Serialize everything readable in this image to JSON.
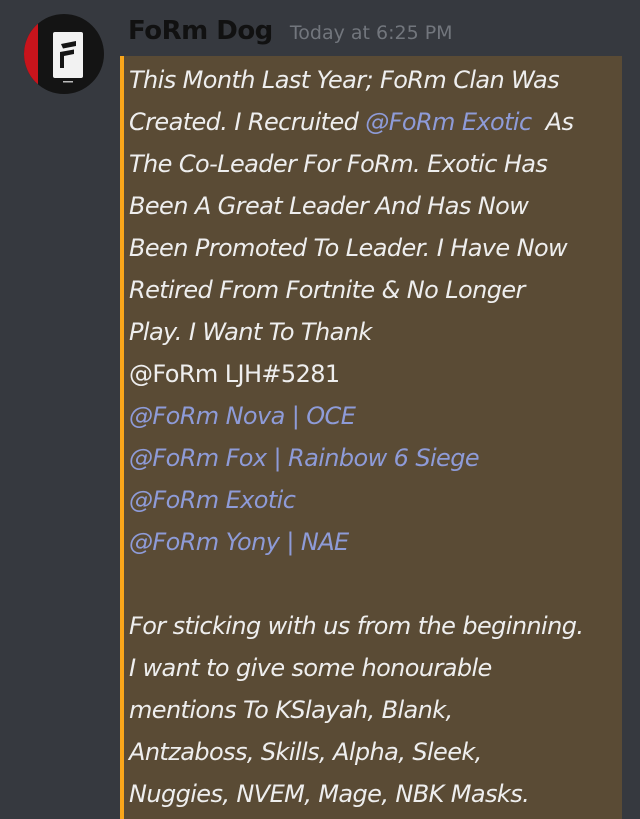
{
  "message": {
    "author": "FoRm Dog",
    "timestamp": "Today at 6:25 PM",
    "intro": {
      "line1": "This Month Last Year; FoRm Clan Was",
      "line2_pre": "Created. I Recruited ",
      "line2_mention": "@FoRm Exotic",
      "line2_post": "  As",
      "line3": "The Co-Leader For FoRm. Exotic Has",
      "line4": "Been A Great Leader And Has Now",
      "line5": "Been Promoted To Leader. I Have Now",
      "line6": "Retired From Fortnite & No Longer",
      "line7": "Play. I Want To Thank"
    },
    "plain_tag": "@FoRm LJH#5281",
    "mentions": [
      "@FoRm Nova | OCE",
      "@FoRm Fox | Rainbow 6 Siege",
      "@FoRm Exotic",
      "@FoRm Yony | NAE"
    ],
    "closing": [
      "For sticking with us from the beginning.",
      "I want to give some honourable",
      "mentions To KSlayah, Blank,",
      "Antzaboss, Skills, Alpha, Sleek,",
      "Nuggies, NVEM, Mage, NBK Masks."
    ]
  },
  "colors": {
    "background": "#36393f",
    "highlight": "#5a4b35",
    "highlight_bar": "#faa61a",
    "mention": "#8e9bd8",
    "text": "#eeeeee",
    "timestamp": "#72767d",
    "username": "#111111"
  },
  "icons": {
    "avatar": "form-clan-logo-avatar"
  }
}
